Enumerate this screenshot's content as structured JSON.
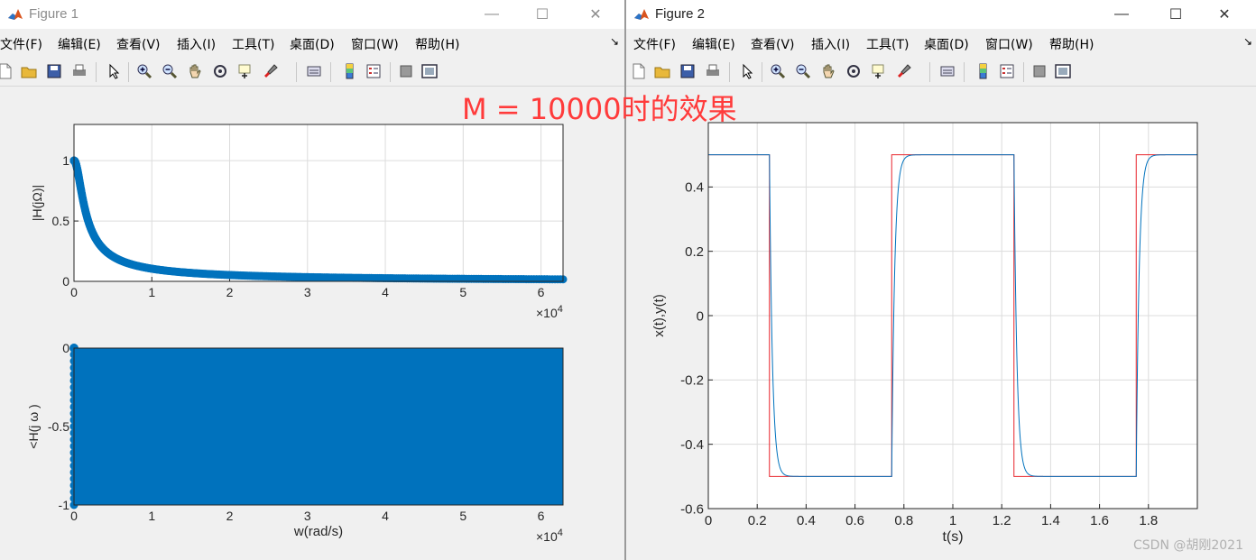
{
  "overlay_text": "M = 10000时的效果",
  "watermark": "CSDN @胡刚2021",
  "menu_items": [
    "文件(F)",
    "编辑(E)",
    "查看(V)",
    "插入(I)",
    "工具(T)",
    "桌面(D)",
    "窗口(W)",
    "帮助(H)"
  ],
  "toolbar_icons": [
    "new-figure-icon",
    "open-icon",
    "save-icon",
    "print-icon",
    "pointer-icon",
    "zoom-in-icon",
    "zoom-out-icon",
    "pan-icon",
    "rotate-icon",
    "data-cursor-icon",
    "brush-icon",
    "link-icon",
    "colorbar-icon",
    "legend-icon",
    "hide-plot-tools-icon",
    "show-plot-tools-icon"
  ],
  "window_controls": {
    "minimize": "—",
    "maximize": "☐",
    "close": "✕"
  },
  "windows": [
    {
      "title": "Figure 1"
    },
    {
      "title": "Figure 2"
    }
  ],
  "chart_data": [
    {
      "type": "scatter",
      "title": "",
      "xlabel": "",
      "ylabel": "|H(jΩ)|",
      "xlim": [
        0,
        62832
      ],
      "ylim": [
        0,
        1.3
      ],
      "x_scale_label": "×10^4",
      "xticks": [
        0,
        1,
        2,
        3,
        4,
        5,
        6
      ],
      "yticks": [
        0,
        0.5,
        1
      ],
      "grid": true,
      "series": [
        {
          "x": [
            0,
            250,
            500,
            1000,
            2000,
            5000,
            10000,
            20000,
            30000,
            40000,
            50000,
            62832
          ],
          "values": [
            1,
            0.97,
            0.89,
            0.7,
            0.45,
            0.2,
            0.1,
            0.05,
            0.033,
            0.025,
            0.02,
            0.016
          ]
        }
      ]
    },
    {
      "type": "scatter",
      "title": "",
      "xlabel": "w(rad/s)",
      "ylabel": "<H(j ω )",
      "xlim": [
        0,
        62832
      ],
      "ylim": [
        -1,
        0
      ],
      "x_scale_label": "×10^4",
      "xticks": [
        0,
        1,
        2,
        3,
        4,
        5,
        6
      ],
      "yticks": [
        -1,
        -0.5,
        0
      ],
      "grid": true,
      "series": [
        {
          "x": [
            0,
            62832
          ],
          "values": [
            0,
            -1
          ]
        }
      ]
    },
    {
      "type": "line",
      "title": "",
      "xlabel": "t(s)",
      "ylabel": "x(t),y(t)",
      "xlim": [
        0,
        2
      ],
      "ylim": [
        -0.6,
        0.6
      ],
      "xticks": [
        0,
        0.2,
        0.4,
        0.6,
        0.8,
        1,
        1.2,
        1.4,
        1.6,
        1.8
      ],
      "yticks": [
        -0.6,
        -0.4,
        -0.2,
        0,
        0.2,
        0.4
      ],
      "grid": true,
      "series": [
        {
          "color": "#e8242b",
          "x": [
            0,
            0.25,
            0.25,
            0.75,
            0.75,
            1.25,
            1.25,
            1.75,
            1.75,
            2
          ],
          "values": [
            0.5,
            0.5,
            -0.5,
            -0.5,
            0.5,
            0.5,
            -0.5,
            -0.5,
            0.5,
            0.5
          ]
        },
        {
          "color": "#0072bd",
          "x": [
            0,
            0.25,
            0.26,
            0.27,
            0.28,
            0.3,
            0.33,
            0.75,
            0.76,
            0.77,
            0.78,
            0.8,
            0.83,
            1.25,
            1.26,
            1.27,
            1.28,
            1.3,
            1.33,
            1.75,
            1.76,
            1.77,
            1.78,
            1.8,
            1.83,
            2
          ],
          "values": [
            0.5,
            0.5,
            0.2,
            -0.15,
            -0.35,
            -0.47,
            -0.5,
            -0.5,
            -0.2,
            0.15,
            0.35,
            0.47,
            0.5,
            0.5,
            0.2,
            -0.15,
            -0.35,
            -0.47,
            -0.5,
            -0.5,
            -0.2,
            0.15,
            0.35,
            0.47,
            0.5,
            0.5
          ]
        }
      ]
    }
  ]
}
